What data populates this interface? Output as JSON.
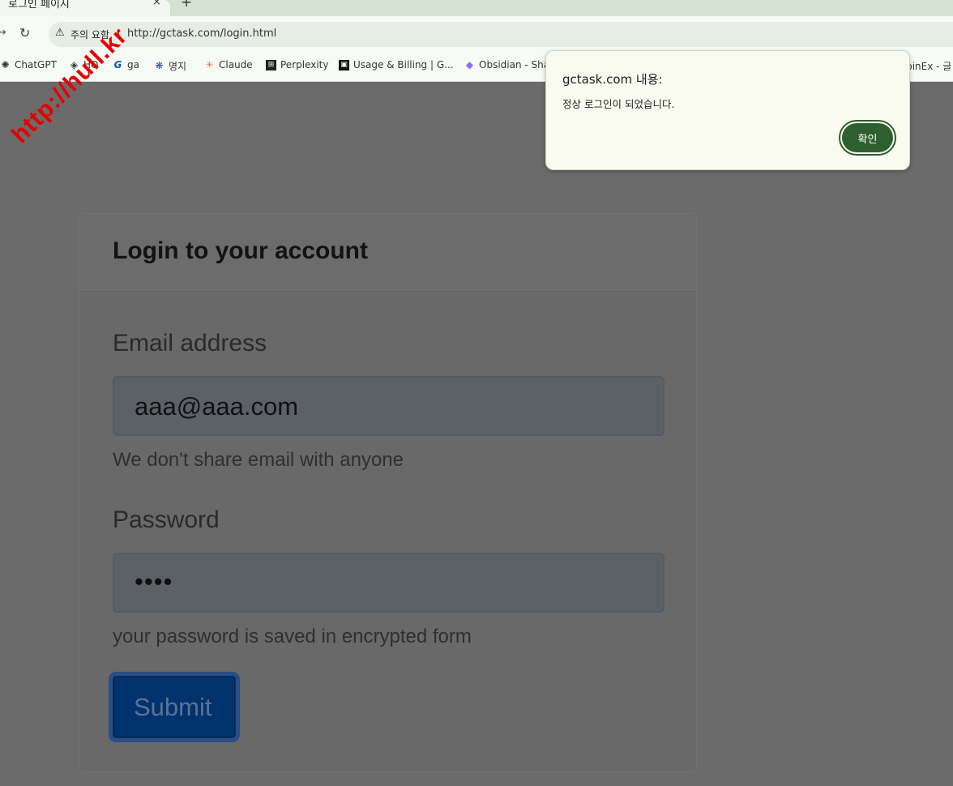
{
  "browser": {
    "tab_title": "로그인 페이지",
    "tab_close": "×",
    "new_tab": "+",
    "security_label": "주의 요함",
    "url": "http://gctask.com/login.html",
    "bookmarks": [
      {
        "label": "ChatGPT",
        "icon": "chatgpt-icon",
        "glyph": "✺"
      },
      {
        "label": "HO",
        "icon": "ho-icon",
        "glyph": "◈"
      },
      {
        "label": "ga",
        "icon": "ga-icon",
        "glyph": "G"
      },
      {
        "label": "명지",
        "icon": "myongji-icon",
        "glyph": "❋"
      },
      {
        "label": "Claude",
        "icon": "claude-icon",
        "glyph": "✳"
      },
      {
        "label": "Perplexity",
        "icon": "perplexity-icon",
        "glyph": "⊞"
      },
      {
        "label": "Usage & Billing | G...",
        "icon": "github-icon",
        "glyph": "▣"
      },
      {
        "label": "Obsidian - Sha",
        "icon": "obsidian-icon",
        "glyph": "◆"
      },
      {
        "label": "CoinEx - 글",
        "icon": "coinex-icon",
        "glyph": ""
      }
    ]
  },
  "watermark": "http://hull.kr",
  "login": {
    "title": "Login to your account",
    "email_label": "Email address",
    "email_value": "aaa@aaa.com",
    "email_help": "We don't share email with anyone",
    "password_label": "Password",
    "password_value": "••••",
    "password_help": "your password is saved in encrypted form",
    "submit_label": "Submit"
  },
  "dialog": {
    "title": "gctask.com 내용:",
    "message": "정상 로그인이 되었습니다.",
    "ok_label": "확인"
  },
  "colors": {
    "dialog_button": "#2f5f2e",
    "submit_button": "#00336e",
    "watermark": "#e60000"
  }
}
